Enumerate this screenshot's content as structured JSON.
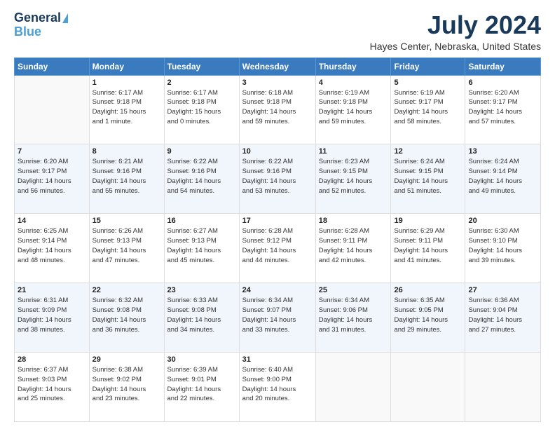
{
  "header": {
    "logo_line1": "General",
    "logo_line2": "Blue",
    "month": "July 2024",
    "location": "Hayes Center, Nebraska, United States"
  },
  "weekdays": [
    "Sunday",
    "Monday",
    "Tuesday",
    "Wednesday",
    "Thursday",
    "Friday",
    "Saturday"
  ],
  "weeks": [
    [
      {
        "day": "",
        "info": ""
      },
      {
        "day": "1",
        "info": "Sunrise: 6:17 AM\nSunset: 9:18 PM\nDaylight: 15 hours\nand 1 minute."
      },
      {
        "day": "2",
        "info": "Sunrise: 6:17 AM\nSunset: 9:18 PM\nDaylight: 15 hours\nand 0 minutes."
      },
      {
        "day": "3",
        "info": "Sunrise: 6:18 AM\nSunset: 9:18 PM\nDaylight: 14 hours\nand 59 minutes."
      },
      {
        "day": "4",
        "info": "Sunrise: 6:19 AM\nSunset: 9:18 PM\nDaylight: 14 hours\nand 59 minutes."
      },
      {
        "day": "5",
        "info": "Sunrise: 6:19 AM\nSunset: 9:17 PM\nDaylight: 14 hours\nand 58 minutes."
      },
      {
        "day": "6",
        "info": "Sunrise: 6:20 AM\nSunset: 9:17 PM\nDaylight: 14 hours\nand 57 minutes."
      }
    ],
    [
      {
        "day": "7",
        "info": "Sunrise: 6:20 AM\nSunset: 9:17 PM\nDaylight: 14 hours\nand 56 minutes."
      },
      {
        "day": "8",
        "info": "Sunrise: 6:21 AM\nSunset: 9:16 PM\nDaylight: 14 hours\nand 55 minutes."
      },
      {
        "day": "9",
        "info": "Sunrise: 6:22 AM\nSunset: 9:16 PM\nDaylight: 14 hours\nand 54 minutes."
      },
      {
        "day": "10",
        "info": "Sunrise: 6:22 AM\nSunset: 9:16 PM\nDaylight: 14 hours\nand 53 minutes."
      },
      {
        "day": "11",
        "info": "Sunrise: 6:23 AM\nSunset: 9:15 PM\nDaylight: 14 hours\nand 52 minutes."
      },
      {
        "day": "12",
        "info": "Sunrise: 6:24 AM\nSunset: 9:15 PM\nDaylight: 14 hours\nand 51 minutes."
      },
      {
        "day": "13",
        "info": "Sunrise: 6:24 AM\nSunset: 9:14 PM\nDaylight: 14 hours\nand 49 minutes."
      }
    ],
    [
      {
        "day": "14",
        "info": "Sunrise: 6:25 AM\nSunset: 9:14 PM\nDaylight: 14 hours\nand 48 minutes."
      },
      {
        "day": "15",
        "info": "Sunrise: 6:26 AM\nSunset: 9:13 PM\nDaylight: 14 hours\nand 47 minutes."
      },
      {
        "day": "16",
        "info": "Sunrise: 6:27 AM\nSunset: 9:13 PM\nDaylight: 14 hours\nand 45 minutes."
      },
      {
        "day": "17",
        "info": "Sunrise: 6:28 AM\nSunset: 9:12 PM\nDaylight: 14 hours\nand 44 minutes."
      },
      {
        "day": "18",
        "info": "Sunrise: 6:28 AM\nSunset: 9:11 PM\nDaylight: 14 hours\nand 42 minutes."
      },
      {
        "day": "19",
        "info": "Sunrise: 6:29 AM\nSunset: 9:11 PM\nDaylight: 14 hours\nand 41 minutes."
      },
      {
        "day": "20",
        "info": "Sunrise: 6:30 AM\nSunset: 9:10 PM\nDaylight: 14 hours\nand 39 minutes."
      }
    ],
    [
      {
        "day": "21",
        "info": "Sunrise: 6:31 AM\nSunset: 9:09 PM\nDaylight: 14 hours\nand 38 minutes."
      },
      {
        "day": "22",
        "info": "Sunrise: 6:32 AM\nSunset: 9:08 PM\nDaylight: 14 hours\nand 36 minutes."
      },
      {
        "day": "23",
        "info": "Sunrise: 6:33 AM\nSunset: 9:08 PM\nDaylight: 14 hours\nand 34 minutes."
      },
      {
        "day": "24",
        "info": "Sunrise: 6:34 AM\nSunset: 9:07 PM\nDaylight: 14 hours\nand 33 minutes."
      },
      {
        "day": "25",
        "info": "Sunrise: 6:34 AM\nSunset: 9:06 PM\nDaylight: 14 hours\nand 31 minutes."
      },
      {
        "day": "26",
        "info": "Sunrise: 6:35 AM\nSunset: 9:05 PM\nDaylight: 14 hours\nand 29 minutes."
      },
      {
        "day": "27",
        "info": "Sunrise: 6:36 AM\nSunset: 9:04 PM\nDaylight: 14 hours\nand 27 minutes."
      }
    ],
    [
      {
        "day": "28",
        "info": "Sunrise: 6:37 AM\nSunset: 9:03 PM\nDaylight: 14 hours\nand 25 minutes."
      },
      {
        "day": "29",
        "info": "Sunrise: 6:38 AM\nSunset: 9:02 PM\nDaylight: 14 hours\nand 23 minutes."
      },
      {
        "day": "30",
        "info": "Sunrise: 6:39 AM\nSunset: 9:01 PM\nDaylight: 14 hours\nand 22 minutes."
      },
      {
        "day": "31",
        "info": "Sunrise: 6:40 AM\nSunset: 9:00 PM\nDaylight: 14 hours\nand 20 minutes."
      },
      {
        "day": "",
        "info": ""
      },
      {
        "day": "",
        "info": ""
      },
      {
        "day": "",
        "info": ""
      }
    ]
  ]
}
